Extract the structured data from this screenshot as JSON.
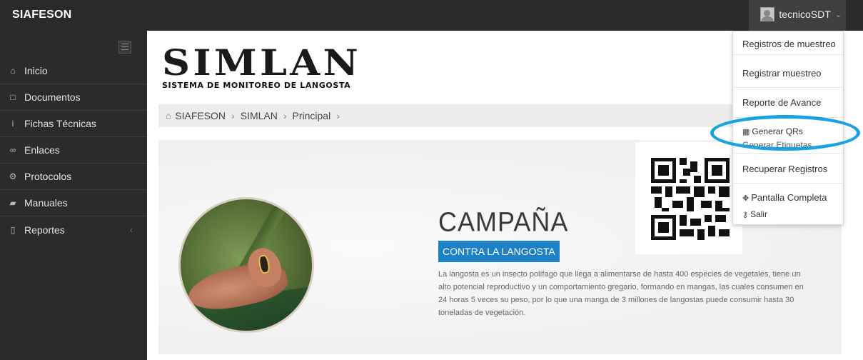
{
  "app": {
    "brand": "SIAFESON",
    "user": "tecnicoSDT"
  },
  "sidebar": {
    "items": [
      {
        "icon": "home-icon",
        "glyph": "⌂",
        "label": "Inicio"
      },
      {
        "icon": "folder-icon",
        "glyph": "□",
        "label": "Documentos"
      },
      {
        "icon": "info-icon",
        "glyph": "i",
        "label": "Fichas Técnicas"
      },
      {
        "icon": "link-icon",
        "glyph": "∞",
        "label": "Enlaces"
      },
      {
        "icon": "gear-icon",
        "glyph": "⚙",
        "label": "Protocolos"
      },
      {
        "icon": "book-icon",
        "glyph": "■",
        "label": "Manuales"
      },
      {
        "icon": "file-icon",
        "glyph": "□",
        "label": "Reportes"
      }
    ]
  },
  "header": {
    "logo_main": "SIMLAN",
    "logo_sub": "SISTEMA DE MONITOREO DE LANGOSTA"
  },
  "breadcrumb": {
    "items": [
      "SIAFESON",
      "SIMLAN",
      "Principal"
    ],
    "separator": "›"
  },
  "banner": {
    "title": "CAMPAÑA",
    "subtitle": "CONTRA LA LANGOSTA",
    "description": "La langosta es un insecto polífago que llega a alimentarse de hasta 400 especies de vegetales, tiene un alto potencial reproductivo y un comportamiento gregario, formando en mangas, las cuales consumen en 24 horas 5 veces su peso, por lo que una manga de 3 millones de langostas puede consumir hasta 30 toneladas de vegetación."
  },
  "user_menu": {
    "items": [
      {
        "label": "Registros de muestreo"
      },
      {
        "label": "Registrar muestreo"
      },
      {
        "label": "Reporte de Avance"
      },
      {
        "label": "Generar QRs",
        "icon": "qr-icon"
      },
      {
        "label": "Generar Etiquetas"
      },
      {
        "label": "Recuperar Registros"
      },
      {
        "label": "Pantalla Completa",
        "icon": "move-icon"
      },
      {
        "label": "Salir",
        "icon": "key-icon"
      }
    ]
  },
  "colors": {
    "accent": "#1f81c5",
    "highlight": "#1aa3e0",
    "sidebar": "#2b2b2b",
    "brand_leaf": "#e0a62a"
  }
}
